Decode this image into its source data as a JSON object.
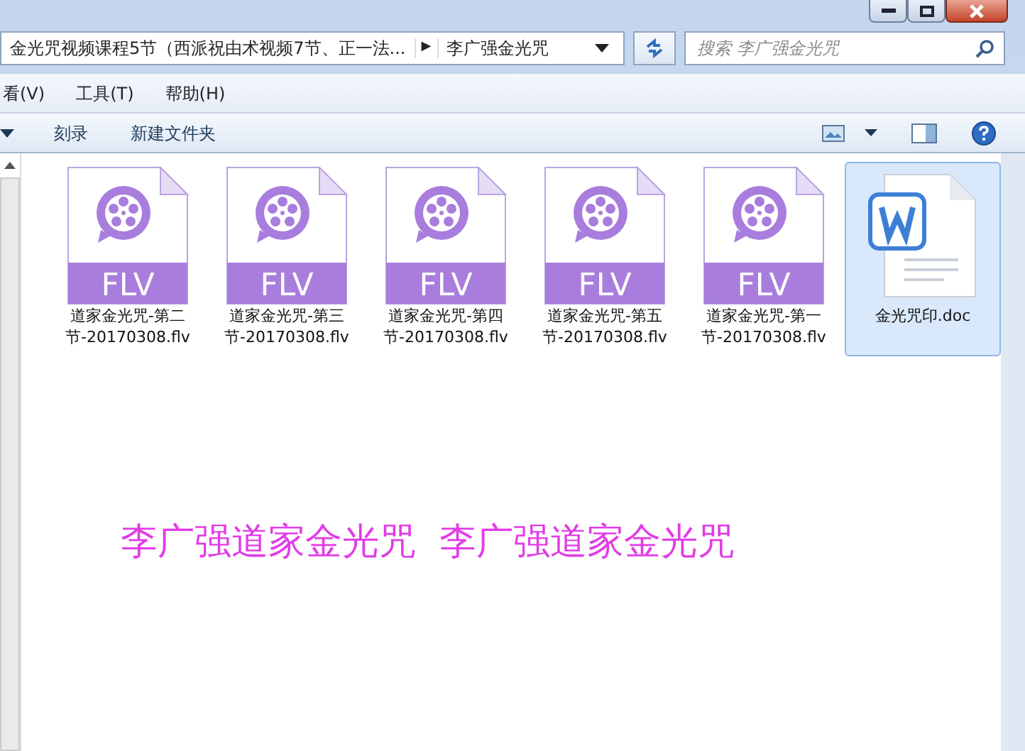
{
  "address_bar": {
    "path": [
      "金光咒视频课程5节（西派祝由术视频7节、正一法...",
      "李广强金光咒"
    ],
    "separator": "▶"
  },
  "search": {
    "placeholder": "搜索 李广强金光咒"
  },
  "menu": [
    "看(V)",
    "工具(T)",
    "帮助(H)"
  ],
  "toolbar": {
    "buttons": [
      "刻录",
      "新建文件夹"
    ]
  },
  "files": [
    {
      "kind": "flv",
      "badge": "FLV",
      "name": "道家金光咒-第二节-20170308.flv",
      "selected": false
    },
    {
      "kind": "flv",
      "badge": "FLV",
      "name": "道家金光咒-第三节-20170308.flv",
      "selected": false
    },
    {
      "kind": "flv",
      "badge": "FLV",
      "name": "道家金光咒-第四节-20170308.flv",
      "selected": false
    },
    {
      "kind": "flv",
      "badge": "FLV",
      "name": "道家金光咒-第五节-20170308.flv",
      "selected": false
    },
    {
      "kind": "flv",
      "badge": "FLV",
      "name": "道家金光咒-第一节-20170308.flv",
      "selected": false
    },
    {
      "kind": "doc",
      "name": "金光咒印.doc",
      "selected": true
    }
  ],
  "overlay_text": "李广强道家金光咒  李广强道家金光咒"
}
